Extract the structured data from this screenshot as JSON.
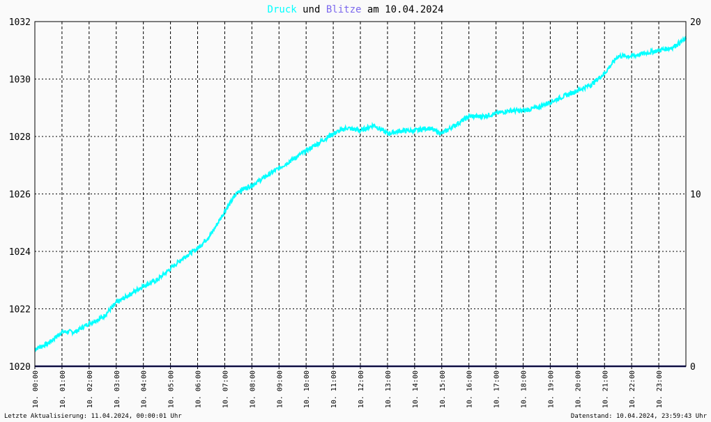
{
  "title": {
    "part1": "Druck",
    "part2": " und ",
    "part3": "Blitze",
    "part4": " am 10.04.2024"
  },
  "colors": {
    "druck": "#00ffff",
    "blitze": "#7b68ee",
    "baseline": "#1a1a7a"
  },
  "footer": {
    "left": "Letzte Aktualisierung: 11.04.2024, 00:00:01 Uhr",
    "right": "Datenstand: 10.04.2024, 23:59:43 Uhr"
  },
  "chart_data": {
    "type": "line",
    "xlabels": [
      "10. 00:00",
      "10. 01:00",
      "10. 02:00",
      "10. 03:00",
      "10. 04:00",
      "10. 05:00",
      "10. 06:00",
      "10. 07:00",
      "10. 08:00",
      "10. 09:00",
      "10. 10:00",
      "10. 11:00",
      "10. 12:00",
      "10. 13:00",
      "10. 14:00",
      "10. 15:00",
      "10. 16:00",
      "10. 17:00",
      "10. 18:00",
      "10. 19:00",
      "10. 20:00",
      "10. 21:00",
      "10. 22:00",
      "10. 23:00"
    ],
    "y_left": {
      "min": 1020,
      "max": 1032,
      "ticks": [
        1020,
        1022,
        1024,
        1026,
        1028,
        1030,
        1032
      ]
    },
    "y_right": {
      "min": 0,
      "max": 20,
      "ticks": [
        0,
        10,
        20
      ]
    },
    "x_range_hours": [
      0,
      24
    ],
    "grid": true,
    "series": [
      {
        "name": "Druck",
        "axis": "left",
        "x": [
          0,
          0.5,
          1,
          1.5,
          2,
          2.5,
          3,
          3.5,
          4,
          4.5,
          5,
          5.5,
          6,
          6.5,
          7,
          7.5,
          8,
          8.5,
          9,
          9.5,
          10,
          10.5,
          11,
          11.5,
          12,
          12.5,
          13,
          13.5,
          14,
          14.5,
          15,
          15.5,
          16,
          16.5,
          17,
          17.5,
          18,
          18.5,
          19,
          19.5,
          20,
          20.5,
          21,
          21.5,
          22,
          22.5,
          23,
          23.5,
          24
        ],
        "values": [
          1020.6,
          1020.8,
          1021.2,
          1021.2,
          1021.5,
          1021.7,
          1022.2,
          1022.5,
          1022.8,
          1023.0,
          1023.4,
          1023.8,
          1024.1,
          1024.6,
          1025.4,
          1026.1,
          1026.3,
          1026.6,
          1026.9,
          1027.2,
          1027.5,
          1027.8,
          1028.1,
          1028.3,
          1028.2,
          1028.4,
          1028.1,
          1028.2,
          1028.2,
          1028.3,
          1028.1,
          1028.4,
          1028.7,
          1028.7,
          1028.8,
          1028.9,
          1028.9,
          1029.0,
          1029.2,
          1029.4,
          1029.6,
          1029.8,
          1030.2,
          1030.8,
          1030.8,
          1030.9,
          1031.0,
          1031.1,
          1031.4
        ]
      },
      {
        "name": "Blitze",
        "axis": "right",
        "x": [
          0,
          24
        ],
        "values": [
          0,
          0
        ]
      }
    ]
  }
}
